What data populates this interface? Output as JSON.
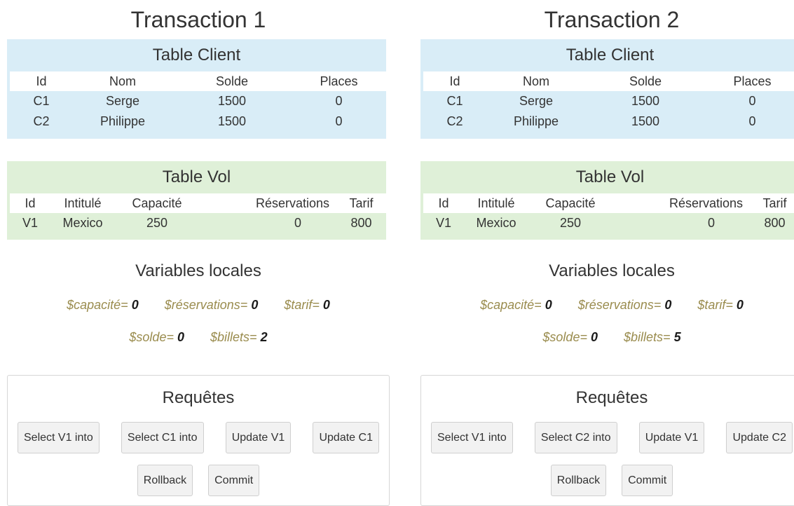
{
  "transactions": [
    {
      "title": "Transaction 1",
      "client": {
        "title": "Table Client",
        "headers": [
          "Id",
          "Nom",
          "Solde",
          "Places"
        ],
        "rows": [
          [
            "C1",
            "Serge",
            "1500",
            "0"
          ],
          [
            "C2",
            "Philippe",
            "1500",
            "0"
          ]
        ]
      },
      "vol": {
        "title": "Table Vol",
        "headers": [
          "Id",
          "Intitulé",
          "Capacité",
          "Réservations",
          "Tarif"
        ],
        "rows": [
          [
            "V1",
            "Mexico",
            "250",
            "0",
            "800"
          ]
        ]
      },
      "variables": {
        "title": "Variables locales",
        "capacite": {
          "name": "$capacité=",
          "value": "0"
        },
        "reservations": {
          "name": "$réservations=",
          "value": "0"
        },
        "tarif": {
          "name": "$tarif=",
          "value": "0"
        },
        "solde": {
          "name": "$solde=",
          "value": "0"
        },
        "billets": {
          "name": "$billets=",
          "value": "2"
        }
      },
      "requetes": {
        "title": "Requêtes",
        "buttons": [
          "Select V1 into",
          "Select C1 into",
          "Update V1",
          "Update C1"
        ],
        "rollback": "Rollback",
        "commit": "Commit"
      }
    },
    {
      "title": "Transaction 2",
      "client": {
        "title": "Table Client",
        "headers": [
          "Id",
          "Nom",
          "Solde",
          "Places"
        ],
        "rows": [
          [
            "C1",
            "Serge",
            "1500",
            "0"
          ],
          [
            "C2",
            "Philippe",
            "1500",
            "0"
          ]
        ]
      },
      "vol": {
        "title": "Table Vol",
        "headers": [
          "Id",
          "Intitulé",
          "Capacité",
          "Réservations",
          "Tarif"
        ],
        "rows": [
          [
            "V1",
            "Mexico",
            "250",
            "0",
            "800"
          ]
        ]
      },
      "variables": {
        "title": "Variables locales",
        "capacite": {
          "name": "$capacité=",
          "value": "0"
        },
        "reservations": {
          "name": "$réservations=",
          "value": "0"
        },
        "tarif": {
          "name": "$tarif=",
          "value": "0"
        },
        "solde": {
          "name": "$solde=",
          "value": "0"
        },
        "billets": {
          "name": "$billets=",
          "value": "5"
        }
      },
      "requetes": {
        "title": "Requêtes",
        "buttons": [
          "Select V1 into",
          "Select C2 into",
          "Update V1",
          "Update C2"
        ],
        "rollback": "Rollback",
        "commit": "Commit"
      }
    }
  ]
}
